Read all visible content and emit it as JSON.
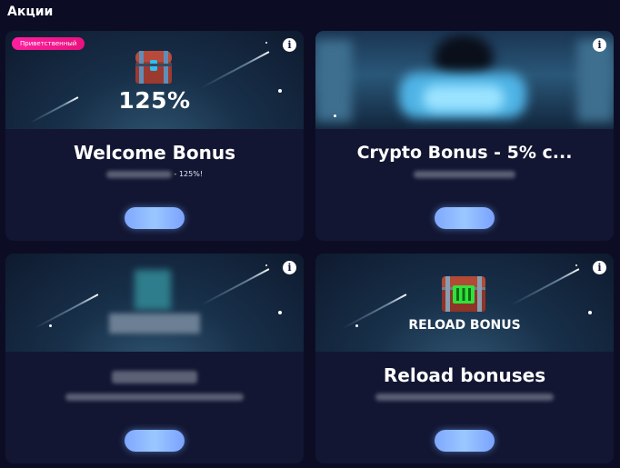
{
  "page": {
    "title": "Акции"
  },
  "cards": [
    {
      "tag": "Приветственный",
      "banner_text": "125%",
      "title": "Welcome Bonus",
      "desc_suffix": "- 125%!",
      "info_glyph": "i",
      "banner_icon": "treasure-chest-icon"
    },
    {
      "title": "Crypto Bonus - 5% c...",
      "info_glyph": "i",
      "banner_icon": "crypto-coins-icon"
    },
    {
      "info_glyph": "i",
      "banner_icon": "blurred-prize-icon"
    },
    {
      "banner_text": "RELOAD BONUS",
      "title": "Reload bonuses",
      "info_glyph": "i",
      "banner_icon": "green-chest-icon"
    }
  ],
  "colors": {
    "background": "#0c0d24",
    "card": "#121632",
    "tag": "#ff1fa0",
    "button": "#8fb8ff"
  }
}
